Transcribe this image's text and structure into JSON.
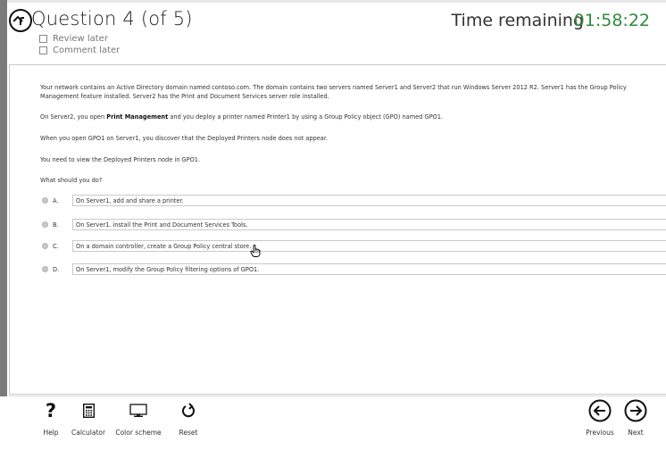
{
  "header": {
    "title": "Question 4 (of 5)",
    "review_later": "Review later",
    "comment_later": "Comment later",
    "time_label": "Time remaining",
    "time_value": "01:58:22"
  },
  "question": {
    "p1": "Your network contains an Active Directory domain named contoso.com. The domain contains two servers named Server1 and Server2 that run Windows Server 2012 R2. Server1 has the Group Policy Management feature installed. Server2 has the Print and Document Services server role installed.",
    "p2_pre": "On Server2, you open ",
    "p2_bold": "Print Management",
    "p2_post": " and you deploy a printer named Printer1 by using a Group Policy object (GPO) named GPO1.",
    "p3": "When you open GPO1 on Server1, you discover that the Deployed Printers node does not appear.",
    "p4": "You need to view the Deployed Printers node in GPO1.",
    "p5": "What should you do?"
  },
  "answers": [
    {
      "letter": "A.",
      "text": "On Server1, add and share a printer."
    },
    {
      "letter": "B.",
      "text": "On Server1. install the Print and Document Services Tools."
    },
    {
      "letter": "C.",
      "text": "On a domain controller, create a Group Policy central store."
    },
    {
      "letter": "D.",
      "text": "On Server1, modify the Group Policy filtering options of GPO1."
    }
  ],
  "toolbar": {
    "help": "Help",
    "calculator": "Calculator",
    "color_scheme": "Color scheme",
    "reset": "Reset",
    "previous": "Previous",
    "next": "Next"
  },
  "colors": {
    "timer": "#2e8b3c",
    "frame": "#7a7a7a"
  }
}
